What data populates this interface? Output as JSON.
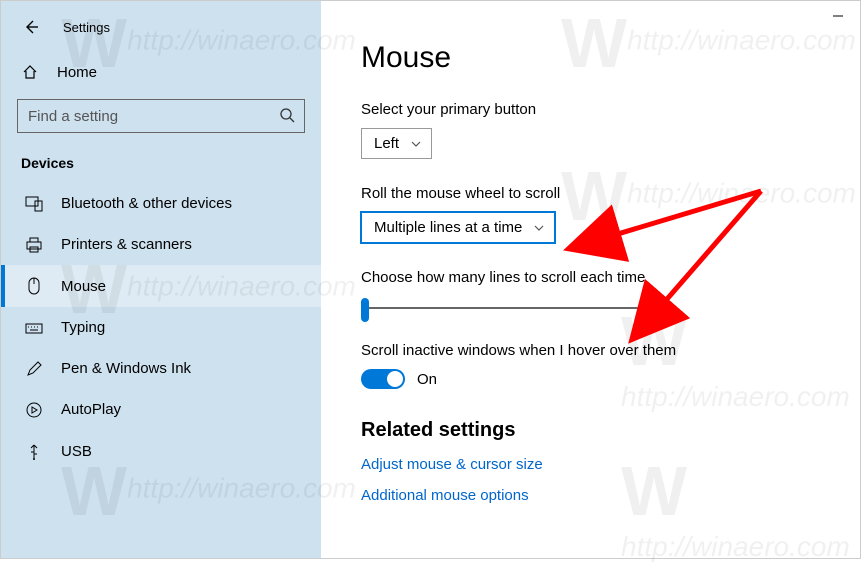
{
  "titlebar": {
    "app_title": "Settings"
  },
  "sidebar": {
    "home_label": "Home",
    "search_placeholder": "Find a setting",
    "section_header": "Devices",
    "items": [
      {
        "label": "Bluetooth & other devices"
      },
      {
        "label": "Printers & scanners"
      },
      {
        "label": "Mouse"
      },
      {
        "label": "Typing"
      },
      {
        "label": "Pen & Windows Ink"
      },
      {
        "label": "AutoPlay"
      },
      {
        "label": "USB"
      }
    ]
  },
  "content": {
    "page_title": "Mouse",
    "primary_button_label": "Select your primary button",
    "primary_button_value": "Left",
    "wheel_label": "Roll the mouse wheel to scroll",
    "wheel_value": "Multiple lines at a time",
    "lines_label": "Choose how many lines to scroll each time",
    "inactive_label": "Scroll inactive windows when I hover over them",
    "toggle_state_label": "On",
    "related_header": "Related settings",
    "link1": "Adjust mouse & cursor size",
    "link2": "Additional mouse options"
  },
  "watermark_text": "http://winaero.com"
}
